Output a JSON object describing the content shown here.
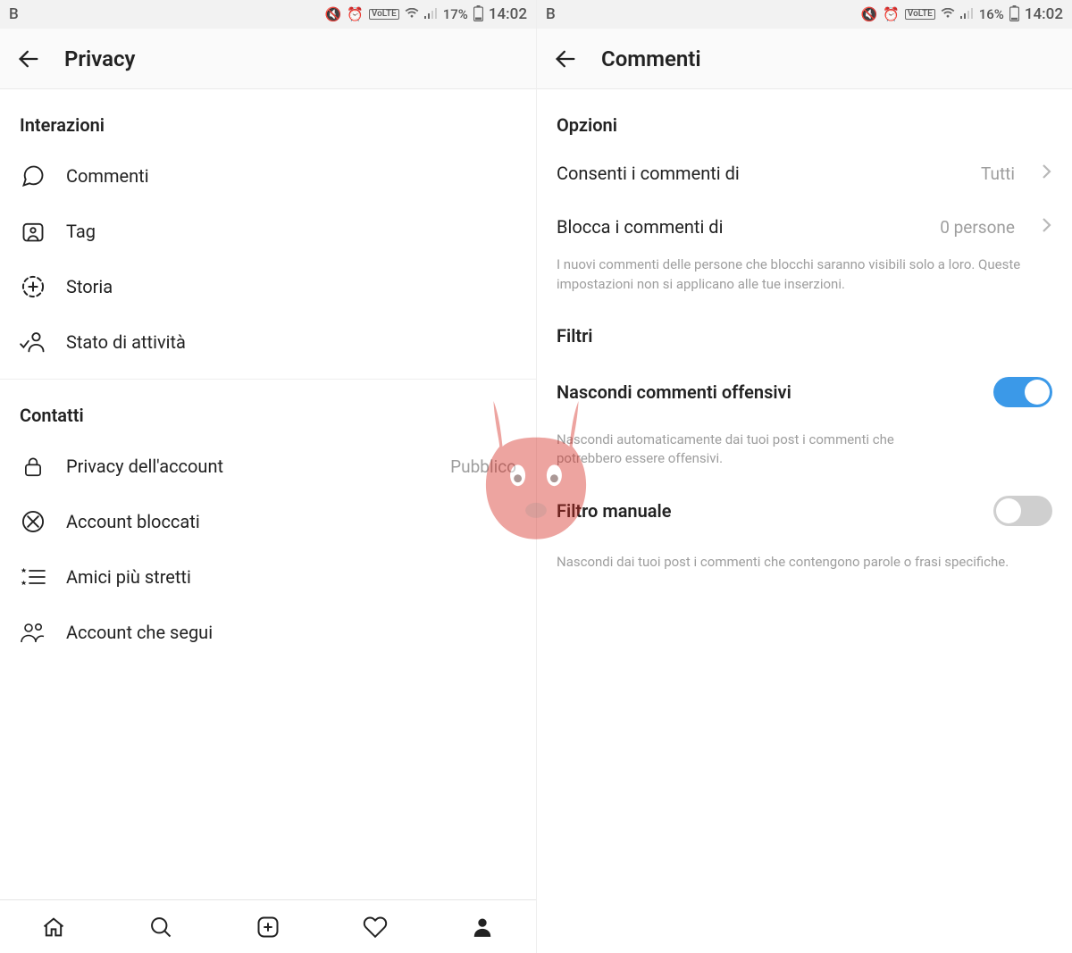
{
  "left": {
    "status": {
      "carrier": "B",
      "battery": "17%",
      "time": "14:02"
    },
    "title": "Privacy",
    "sections": {
      "interactions": {
        "header": "Interazioni",
        "items": {
          "comments": "Commenti",
          "tag": "Tag",
          "story": "Storia",
          "activity": "Stato di attività"
        }
      },
      "contacts": {
        "header": "Contatti",
        "items": {
          "accountPrivacy": "Privacy dell'account",
          "accountPrivacyValue": "Pubblico",
          "blocked": "Account bloccati",
          "closeFriends": "Amici più stretti",
          "following": "Account che segui"
        }
      }
    }
  },
  "right": {
    "status": {
      "carrier": "B",
      "battery": "16%",
      "time": "14:02"
    },
    "title": "Commenti",
    "options": {
      "header": "Opzioni",
      "allowLabel": "Consenti i commenti di",
      "allowValue": "Tutti",
      "blockLabel": "Blocca i commenti di",
      "blockValue": "0 persone",
      "helper": "I nuovi commenti delle persone che blocchi saranno visibili solo a loro. Queste impostazioni non si applicano alle tue inserzioni."
    },
    "filters": {
      "header": "Filtri",
      "hideOffensive": "Nascondi commenti offensivi",
      "hideOffensiveHelper": "Nascondi automaticamente dai tuoi post i commenti che potrebbero essere offensivi.",
      "manualFilter": "Filtro manuale",
      "manualFilterHelper": "Nascondi dai tuoi post i commenti che contengono parole o frasi specifiche."
    }
  },
  "colors": {
    "toggleOn": "#3b99e8"
  }
}
